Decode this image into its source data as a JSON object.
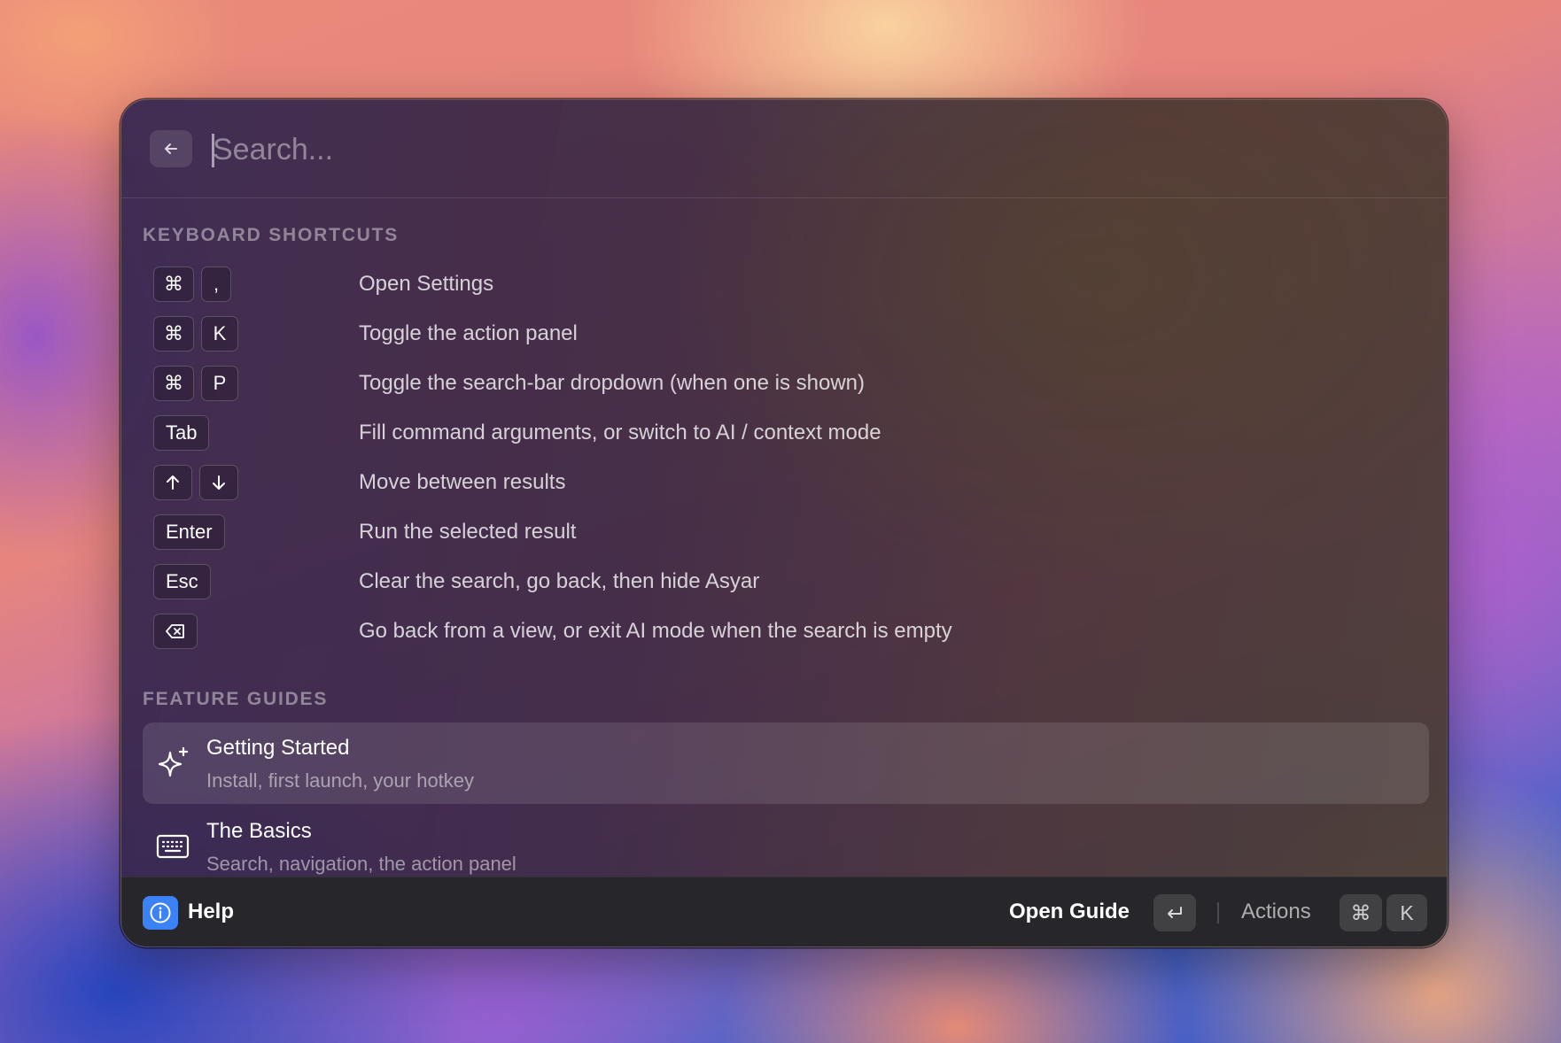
{
  "search": {
    "placeholder": "Search...",
    "value": ""
  },
  "sections": {
    "shortcuts_header": "KEYBOARD SHORTCUTS",
    "guides_header": "FEATURE GUIDES"
  },
  "shortcuts": [
    {
      "keys": [
        "⌘",
        ","
      ],
      "description": "Open Settings"
    },
    {
      "keys": [
        "⌘",
        "K"
      ],
      "description": "Toggle the action panel"
    },
    {
      "keys": [
        "⌘",
        "P"
      ],
      "description": "Toggle the search-bar dropdown (when one is shown)"
    },
    {
      "keys": [
        "Tab"
      ],
      "description": "Fill command arguments, or switch to AI / context mode"
    },
    {
      "keys": [
        "↑",
        "↓"
      ],
      "description": "Move between results"
    },
    {
      "keys": [
        "Enter"
      ],
      "description": "Run the selected result"
    },
    {
      "keys": [
        "Esc"
      ],
      "description": "Clear the search, go back, then hide Asyar"
    },
    {
      "keys": [
        "⌫"
      ],
      "description": "Go back from a view, or exit AI mode when the search is empty"
    }
  ],
  "guides": [
    {
      "title": "Getting Started",
      "subtitle": "Install, first launch, your hotkey",
      "icon": "sparkle-icon"
    },
    {
      "title": "The Basics",
      "subtitle": "Search, navigation, the action panel",
      "icon": "keyboard-icon"
    }
  ],
  "footer": {
    "title": "Help",
    "icon": "info-icon",
    "primary_action": "Open Guide",
    "primary_key": "↵",
    "actions_label": "Actions",
    "actions_keys": [
      "⌘",
      "K"
    ]
  },
  "colors": {
    "accent": "#3b82f6"
  }
}
